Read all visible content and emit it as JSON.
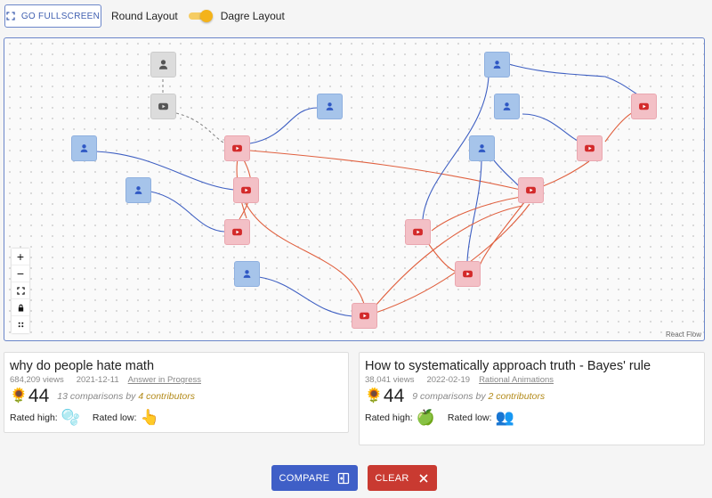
{
  "toolbar": {
    "fullscreen_label": "GO FULLSCREEN",
    "round_layout_label": "Round Layout",
    "dagre_layout_label": "Dagre Layout",
    "toggle_on": true
  },
  "graph": {
    "attribution": "React Flow",
    "controls": {
      "zoom_in": "+",
      "zoom_out": "−"
    },
    "colors": {
      "user_node": "#a6c4ea",
      "video_node": "#f3c0c6",
      "pending_node": "#dcdcdc",
      "user_edge": "#3e5fc2",
      "video_edge": "#e0603f",
      "pending_edge": "#888888"
    }
  },
  "cards": {
    "left": {
      "title": "why do people hate math",
      "views": "684,209 views",
      "date": "2021-12-11",
      "link": "Answer in Progress",
      "score_icon": "🌻",
      "score": "44",
      "comparisons": "13 comparisons by",
      "contributors": "4 contributors",
      "rated_high_label": "Rated high:",
      "rated_high_icon": "🫧",
      "rated_low_label": "Rated low:",
      "rated_low_icon": "👆"
    },
    "right": {
      "title": "How to systematically approach truth - Bayes' rule",
      "views": "38,041 views",
      "date": "2022-02-19",
      "link": "Rational Animations",
      "score_icon": "🌻",
      "score": "44",
      "comparisons": "9 comparisons by",
      "contributors": "2 contributors",
      "rated_high_label": "Rated high:",
      "rated_high_icon": "🍏",
      "rated_low_label": "Rated low:",
      "rated_low_icon": "👥"
    }
  },
  "actions": {
    "compare_label": "COMPARE",
    "clear_label": "CLEAR",
    "compare_color": "#3f5fc7",
    "clear_color": "#c93a31"
  }
}
